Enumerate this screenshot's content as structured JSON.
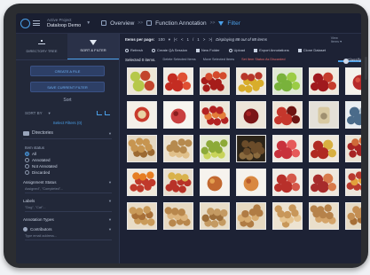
{
  "header": {
    "project_label": "Active Project",
    "project_name": "Dataloop Demo",
    "crumbs": [
      "Overview",
      "Function Annotation",
      "Filter"
    ]
  },
  "sidebar": {
    "tabs": [
      "DIRECTORY TREE",
      "SORT & FILTER"
    ],
    "create_filter": "CREATE A FILE",
    "save_filter": "SAVE CURRENT FILTER",
    "sort_label": "Sort",
    "sort_by": "SORT BY",
    "select_filters": "Select Filters (0)",
    "directories": "Directories",
    "item_status": "Item status",
    "statuses": [
      "All",
      "Annotated",
      "Not Annotated",
      "Discarded"
    ],
    "assignment_status": "Assignment Status",
    "assignment_values": "Assigned\", \"Completed\"...",
    "labels": "Labels",
    "labels_values": "\"Dog\", \"Cat\"...",
    "annotation_types": "Annotation Types",
    "contributors": "Contributors",
    "contributors_hint": "Type email address..."
  },
  "main": {
    "items_per_page_label": "Items per page:",
    "items_per_page": "100",
    "page_current": "1",
    "page_total": "1",
    "display_text": "Displaying 88 out of 88 items",
    "view_label": "View",
    "view_mode": "Items",
    "toolbar": [
      "Refresh",
      "Create QA Session",
      "New Folder",
      "Upload",
      "Export Annotations",
      "Clone Dataset"
    ],
    "selected_text": "Selected 0 items.",
    "actions": [
      "Delete Selected Items",
      "Move Selected Items",
      "Set Item Status As Discarded"
    ],
    "classify": "Classify"
  },
  "colors": {
    "accent": "#4a9fe8",
    "background": "#1d2235",
    "sidebar": "#222839",
    "danger": "#e26a6a"
  },
  "gallery": {
    "tiles": [
      {
        "kind": "apples",
        "bg": "#ece6d6",
        "fruit": "#b6c84a",
        "fruit2": "#c2452d"
      },
      {
        "kind": "cluster",
        "bg": "#f1ece4",
        "fruit": "#c42c22",
        "fruit2": "#e04f33"
      },
      {
        "kind": "pile",
        "bg": "#e7e0d2",
        "fruit": "#a61c1a",
        "fruit2": "#d44a2c"
      },
      {
        "kind": "pile",
        "bg": "#efe9dc",
        "fruit": "#d8ad2b",
        "fruit2": "#b7372a"
      },
      {
        "kind": "cluster",
        "bg": "#dfe9d4",
        "fruit": "#79b23b",
        "fruit2": "#9bcc46"
      },
      {
        "kind": "cluster",
        "bg": "#f0eade",
        "fruit": "#a0191e",
        "fruit2": "#c53c2c"
      },
      {
        "kind": "single",
        "bg": "#f5f2ec",
        "fruit": "#b62a2a",
        "fruit2": "#d65040"
      },
      {
        "kind": "slices",
        "bg": "#f3efe8",
        "fruit": "#c83a2c",
        "fruit2": "#e8d2a4"
      },
      {
        "kind": "single",
        "bg": "#f7f5f0",
        "fruit": "#c94040",
        "fruit2": "#8a1e1e"
      },
      {
        "kind": "pile",
        "bg": "#eee6d8",
        "fruit": "#b22222",
        "fruit2": "#e37d3a"
      },
      {
        "kind": "single",
        "bg": "#ece5d9",
        "fruit": "#7a1517",
        "fruit2": "#a42224"
      },
      {
        "kind": "cluster",
        "bg": "#efe6d8",
        "fruit": "#c5372c",
        "fruit2": "#6e1512"
      },
      {
        "kind": "jar",
        "bg": "#e4e0d8",
        "fruit": "#d8c9a2",
        "fruit2": "#a09070"
      },
      {
        "kind": "cluster",
        "bg": "#eaeef2",
        "fruit": "#4a6b8a",
        "fruit2": "#9fb3c4"
      },
      {
        "kind": "pile",
        "bg": "#e4d8c2",
        "fruit": "#c79550",
        "fruit2": "#9c6a32"
      },
      {
        "kind": "pile",
        "bg": "#ece2cf",
        "fruit": "#b68a4e",
        "fruit2": "#e0c08a"
      },
      {
        "kind": "pile",
        "bg": "#e6ead2",
        "fruit": "#8daa38",
        "fruit2": "#c8d45a"
      },
      {
        "kind": "pile",
        "bg": "#2c2418",
        "fruit": "#6b4c2a",
        "fruit2": "#8a6a3e"
      },
      {
        "kind": "cluster",
        "bg": "#f0ebe3",
        "fruit": "#c8323c",
        "fruit2": "#e65a5a"
      },
      {
        "kind": "cluster",
        "bg": "#efe8dc",
        "fruit": "#b02a22",
        "fruit2": "#d8b040"
      },
      {
        "kind": "pile",
        "bg": "#ebe3d4",
        "fruit": "#a82424",
        "fruit2": "#cf6a3a"
      },
      {
        "kind": "pile",
        "bg": "#f0e9dc",
        "fruit": "#c0392b",
        "fruit2": "#e67e22"
      },
      {
        "kind": "pile",
        "bg": "#e8dfd0",
        "fruit": "#b83228",
        "fruit2": "#d9b24a"
      },
      {
        "kind": "single",
        "bg": "#f6f3ee",
        "fruit": "#c26830",
        "fruit2": "#e4a050"
      },
      {
        "kind": "single",
        "bg": "#f5f2ec",
        "fruit": "#d98840",
        "fruit2": "#b85a2a"
      },
      {
        "kind": "cluster",
        "bg": "#f1ece5",
        "fruit": "#b8302a",
        "fruit2": "#d5584a"
      },
      {
        "kind": "cluster",
        "bg": "#efe7dc",
        "fruit": "#a72b2b",
        "fruit2": "#d87a4a"
      },
      {
        "kind": "pile",
        "bg": "#ede6db",
        "fruit": "#b93a2e",
        "fruit2": "#e2a13c"
      },
      {
        "kind": "pile",
        "bg": "#e9dcc6",
        "fruit": "#c99a5a",
        "fruit2": "#a87038"
      },
      {
        "kind": "pile",
        "bg": "#e7dac3",
        "fruit": "#b8874c",
        "fruit2": "#dcb47c"
      },
      {
        "kind": "pile",
        "bg": "#e8ddc8",
        "fruit": "#c49a62",
        "fruit2": "#9c6e3a"
      },
      {
        "kind": "pile",
        "bg": "#e6d9c1",
        "fruit": "#b07c44",
        "fruit2": "#d8ac70"
      },
      {
        "kind": "pile",
        "bg": "#ede3d1",
        "fruit": "#c8975a",
        "fruit2": "#e6c490"
      },
      {
        "kind": "pile",
        "bg": "#eadfcb",
        "fruit": "#b6824a",
        "fruit2": "#d4a46a"
      },
      {
        "kind": "pile",
        "bg": "#e6dac4",
        "fruit": "#c48e52",
        "fruit2": "#a66e36"
      }
    ]
  }
}
